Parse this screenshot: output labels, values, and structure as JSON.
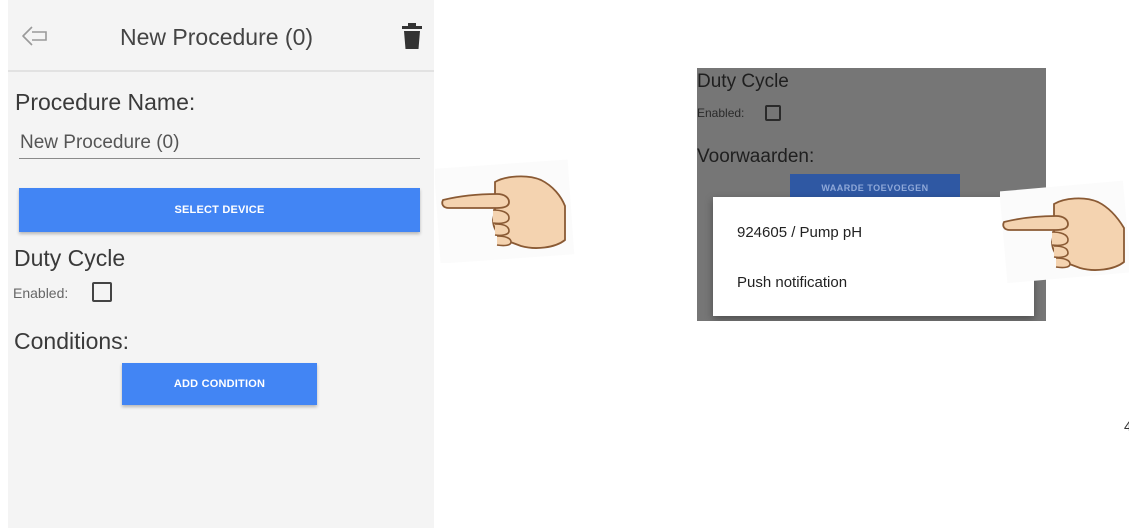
{
  "left_screen": {
    "title": "New Procedure (0)",
    "procedure_name_label": "Procedure Name:",
    "procedure_name_value": "New Procedure (0)",
    "select_device_label": "SELECT DEVICE",
    "duty_cycle_label": "Duty Cycle",
    "enabled_label": "Enabled:",
    "enabled_checked": false,
    "conditions_label": "Conditions:",
    "add_condition_label": "ADD CONDITION",
    "accent_color": "#4285f4"
  },
  "right_screen": {
    "duty_cycle_label": "Duty Cycle",
    "enabled_label": "Enabled:",
    "conditions_label": "Voorwaarden:",
    "add_condition_label": "WAARDE TOEVOEGEN",
    "menu_items": [
      "924605 / Pump pH",
      "Push notification"
    ]
  },
  "edge_mark": "4",
  "icons": [
    "back-arrow-icon",
    "trash-icon",
    "pointing-hand-icon"
  ]
}
